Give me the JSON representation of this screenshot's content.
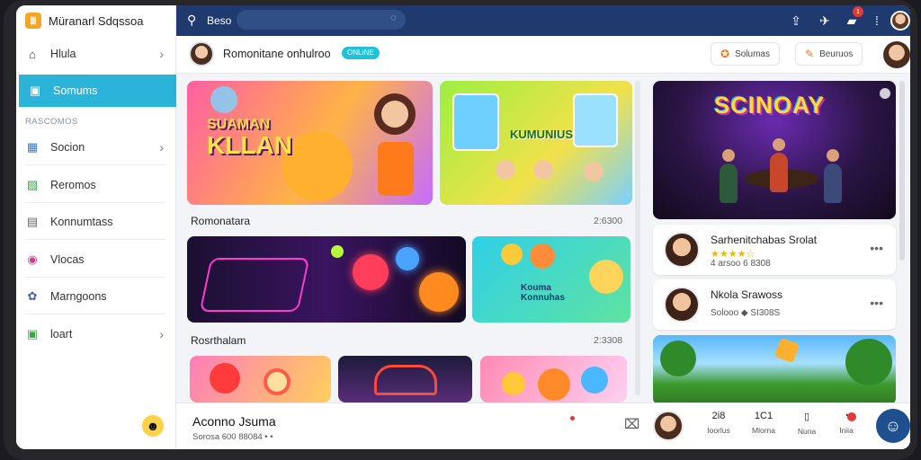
{
  "app": {
    "name": "Müranarl Sdqssoa",
    "logo_glyph": "Ⅲ"
  },
  "sidebar": {
    "section_label": "RASCOMOS",
    "items": [
      {
        "label": "Hlula",
        "icon": "home-icon",
        "glyph": "⌂",
        "chevron": "›"
      },
      {
        "label": "Somums",
        "icon": "image-icon",
        "glyph": "▣",
        "active": true
      },
      {
        "label": "Socion",
        "icon": "gamepad-icon",
        "glyph": "▦",
        "chevron": "›"
      },
      {
        "label": "Reromos",
        "icon": "picture-icon",
        "glyph": "▨"
      },
      {
        "label": "Konnumtass",
        "icon": "document-icon",
        "glyph": "▤"
      },
      {
        "label": "Vlocas",
        "icon": "music-icon",
        "glyph": "◉"
      },
      {
        "label": "Marngoons",
        "icon": "users-icon",
        "glyph": "✿"
      },
      {
        "label": "loart",
        "icon": "cart-icon",
        "glyph": "▣",
        "chevron": "›"
      }
    ],
    "footer_emoji": "☻"
  },
  "topbar": {
    "search_label": "Beso",
    "search_placeholder": "",
    "notification_count": "1"
  },
  "subheader": {
    "title": "Romonitane onhulroo",
    "badge": "ONLINE",
    "button1": "Solumas",
    "button2": "Beuruos"
  },
  "main": {
    "hero1_text": "SUAMAN",
    "hero1_text2": "KLLAN",
    "hero2_text": "KUMUNIUS",
    "section1": {
      "title": "Romonatara",
      "count": "2:6300"
    },
    "section2": {
      "title": "Rosrthalam",
      "count": "2:3308"
    },
    "row2b_text": "Kouma\nKonnuhas"
  },
  "right": {
    "feature_title": "SCINOAY",
    "list": [
      {
        "name": "Sarhenitchabas Srolat",
        "stars": "★★★★☆",
        "meta": "4 arsoo  6  8308"
      },
      {
        "name": "Nkola Srawoss",
        "stars": "",
        "meta": "Solooo  ◆  SI308S"
      }
    ]
  },
  "bottom": {
    "title": "Aconno Jsuma",
    "subtitle": "Sorosa  600 88084 • •",
    "stats": [
      {
        "value": "2i8",
        "label": "Ioorlus"
      },
      {
        "value": "1C1",
        "label": "Mlorna"
      },
      {
        "value": "",
        "label": "Nuna"
      },
      {
        "value": "",
        "label": "Iniia"
      }
    ]
  },
  "colors": {
    "accent": "#2bb3d9",
    "topbar": "#1e3a6e",
    "danger": "#e53935"
  }
}
